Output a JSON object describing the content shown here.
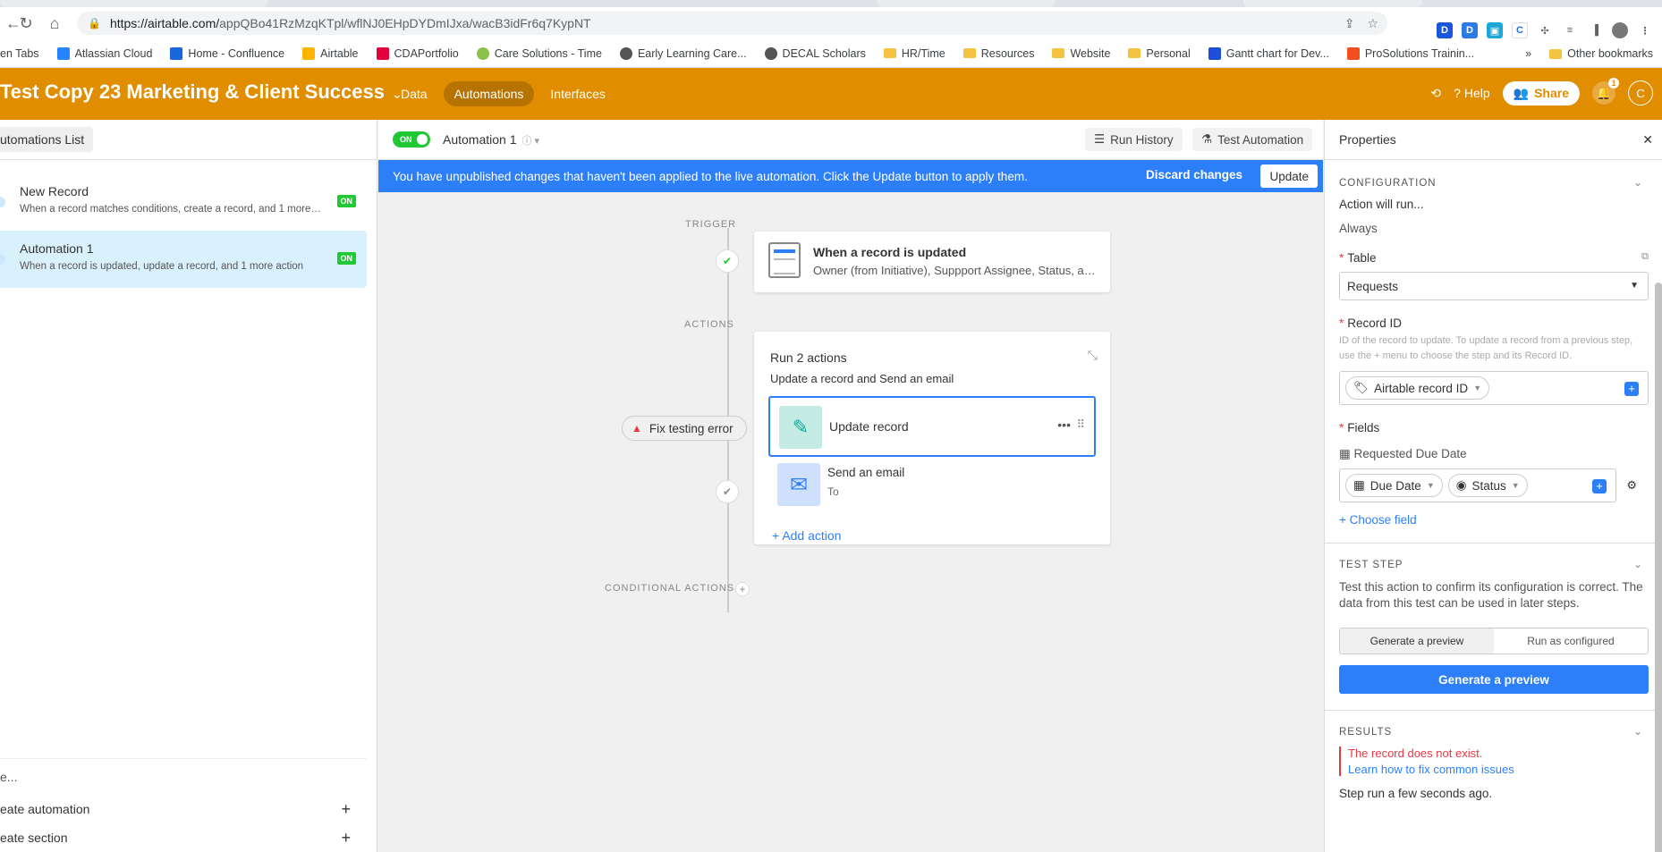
{
  "browser": {
    "url_host": "https://airtable.com/",
    "url_path": "appQBo41RzMzqKTpl/wflNJ0EHpDYDmIJxa/wacB3idFr6q7KypNT",
    "bookmarks": [
      "en Tabs",
      "Atlassian Cloud",
      "Home - Confluence",
      "Airtable",
      "CDAPortfolio",
      "Care Solutions - Time",
      "Early Learning Care...",
      "DECAL Scholars",
      "HR/Time",
      "Resources",
      "Website",
      "Personal",
      "Gantt chart for Dev...",
      "ProSolutions Trainin..."
    ],
    "more_bookmarks": "»",
    "other_bookmarks": "Other bookmarks"
  },
  "app": {
    "base_title": "Test Copy 23 Marketing & Client Success",
    "nav": [
      "Data",
      "Automations",
      "Interfaces"
    ],
    "help": "Help",
    "share": "Share",
    "notif_count": "1",
    "avatar_initial": "C",
    "brand_color": "#e08d00"
  },
  "sidebar": {
    "header": "utomations List",
    "items": [
      {
        "title": "New Record",
        "desc": "When a record matches conditions, create a record, and 1 more act...",
        "status": "ON"
      },
      {
        "title": "Automation 1",
        "desc": "When a record is updated, update a record, and 1 more action",
        "status": "ON"
      }
    ],
    "footer_hint": "e...",
    "create_automation": "eate automation",
    "create_section": "eate section"
  },
  "toolbar": {
    "toggle": "ON",
    "automation_name": "Automation 1",
    "run_history": "Run History",
    "test_automation": "Test Automation"
  },
  "banner": {
    "message": "You have unpublished changes that haven't been applied to the live automation. Click the Update button to apply them.",
    "discard": "Discard changes",
    "update": "Update"
  },
  "canvas": {
    "trigger_label": "TRIGGER",
    "actions_label": "ACTIONS",
    "conditional_label": "CONDITIONAL ACTIONS",
    "trigger_title": "When a record is updated",
    "trigger_sub": "Owner (from Initiative), Suppport Assignee, Status, an...",
    "actions_title": "Run 2 actions",
    "actions_sub": "Update a record and Send an email",
    "action1": "Update record",
    "action2": "Send an email",
    "action2_to": "To",
    "add_action": "Add action",
    "fix_error": "Fix testing error"
  },
  "properties": {
    "title": "Properties",
    "configuration": "CONFIGURATION",
    "action_will_run": "Action will run...",
    "always": "Always",
    "table_label": "Table",
    "table_value": "Requests",
    "record_id_label": "Record ID",
    "record_id_help": "ID of the record to update. To update a record from a previous step, use the + menu to choose the step and its Record ID.",
    "record_id_token": "Airtable record ID",
    "fields_label": "Fields",
    "requested_due_date": "Requested Due Date",
    "token_due_date": "Due Date",
    "token_status": "Status",
    "choose_field": "Choose field",
    "test_step": "TEST STEP",
    "test_step_desc": "Test this action to confirm its configuration is correct. The data from this test can be used in later steps.",
    "tab_preview": "Generate a preview",
    "tab_run": "Run as configured",
    "generate_btn": "Generate a preview",
    "results": "RESULTS",
    "error": "The record does not exist.",
    "learn": "Learn how to fix common issues",
    "step_run": "Step run a few seconds ago."
  }
}
